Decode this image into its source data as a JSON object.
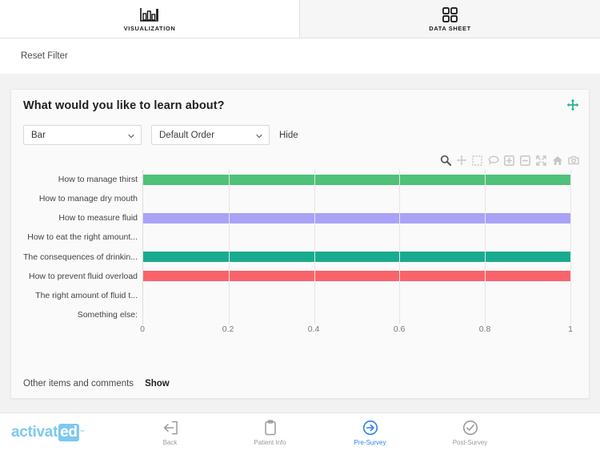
{
  "tabs": [
    {
      "label": "VISUALIZATION",
      "icon": "bar-chart-icon",
      "active": true
    },
    {
      "label": "DATA SHEET",
      "icon": "grid-icon",
      "active": false
    }
  ],
  "toolbar": {
    "reset_filter_label": "Reset Filter"
  },
  "card": {
    "title": "What would you like to learn about?",
    "move_handle_icon": "move-handle-icon",
    "move_handle_color": "#2bb295",
    "chart_type_select": {
      "value": "Bar",
      "caret_icon": "chevron-down-icon"
    },
    "order_select": {
      "value": "Default Order",
      "caret_icon": "chevron-down-icon"
    },
    "hide_label": "Hide",
    "other_items_label": "Other items and comments",
    "show_label": "Show"
  },
  "modebar": [
    {
      "name": "zoom-icon",
      "label": "Zoom",
      "active": true
    },
    {
      "name": "pan-icon",
      "label": "Pan",
      "active": false
    },
    {
      "name": "box-select-icon",
      "label": "Box Select",
      "active": false
    },
    {
      "name": "lasso-select-icon",
      "label": "Lasso Select",
      "active": false
    },
    {
      "name": "zoom-in-icon",
      "label": "Zoom in",
      "active": false
    },
    {
      "name": "zoom-out-icon",
      "label": "Zoom out",
      "active": false
    },
    {
      "name": "autoscale-icon",
      "label": "Autoscale",
      "active": false
    },
    {
      "name": "reset-axes-home-icon",
      "label": "Reset axes",
      "active": false
    },
    {
      "name": "camera-icon",
      "label": "Download plot as png",
      "active": false
    }
  ],
  "chart_data": {
    "type": "bar",
    "orientation": "horizontal",
    "title": "What would you like to learn about?",
    "xlabel": "",
    "ylabel": "",
    "xlim": [
      0,
      1
    ],
    "xticks": [
      "0",
      "0.2",
      "0.4",
      "0.6",
      "0.8",
      "1"
    ],
    "xtick_values": [
      0,
      0.2,
      0.4,
      0.6,
      0.8,
      1
    ],
    "grid": true,
    "legend": "none",
    "categories": [
      "How to manage thirst",
      "How to manage dry mouth",
      "How to measure fluid",
      "How to eat the right amount...",
      "The consequences of drinkin...",
      "How to prevent fluid overload",
      "The right amount of fluid t...",
      "Something else:"
    ],
    "values": [
      1,
      0,
      1,
      0,
      1,
      1,
      0,
      0
    ],
    "colors": [
      "#4fc178",
      "#a9a2f6",
      "#a9a2f6",
      "#a9a2f6",
      "#1aab8e",
      "#f9636b",
      "#f9636b",
      "#f9636b"
    ]
  },
  "bottom_nav": {
    "logo": {
      "text_main": "activat",
      "text_boxed": "ed",
      "trademark": "™"
    },
    "items": [
      {
        "label": "Back",
        "icon": "exit-arrow-icon",
        "active": false
      },
      {
        "label": "Patient Info",
        "icon": "clipboard-icon",
        "active": false
      },
      {
        "label": "Pre-Survey",
        "icon": "arrow-right-circle-icon",
        "active": true
      },
      {
        "label": "Post-Survey",
        "icon": "check-circle-icon",
        "active": false
      }
    ]
  }
}
